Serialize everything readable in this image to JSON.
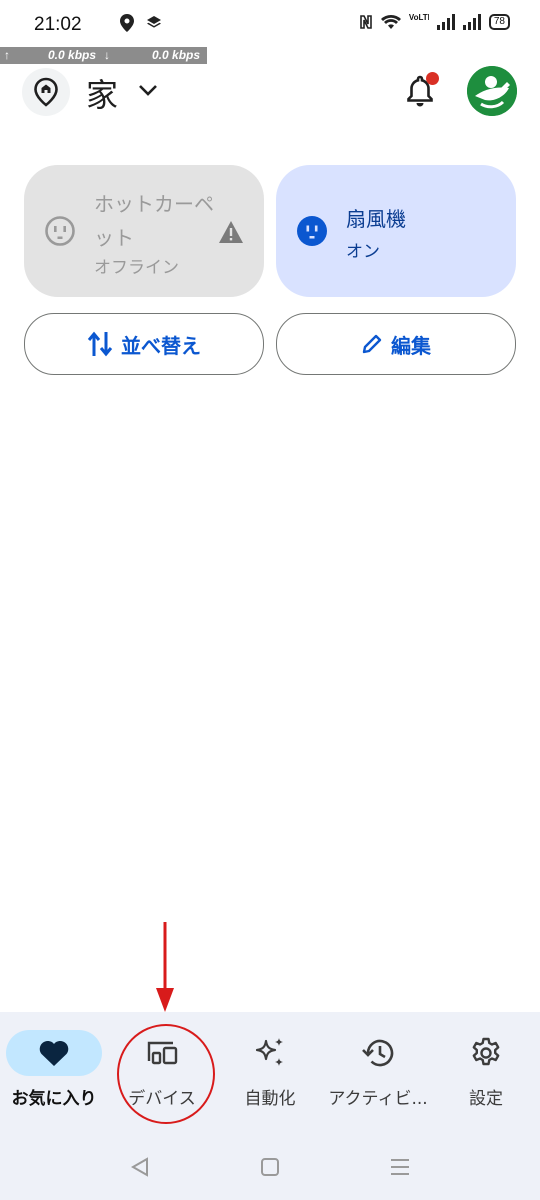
{
  "status_bar": {
    "time": "21:02",
    "battery": "78",
    "signal_tag": "VoLTE"
  },
  "network_speed": {
    "upload": "0.0 kbps",
    "download": "0.0 kbps"
  },
  "header": {
    "home_name": "家"
  },
  "devices": [
    {
      "name": "ホットカーペット",
      "status": "オフライン",
      "state": "offline"
    },
    {
      "name": "扇風機",
      "status": "オン",
      "state": "on"
    }
  ],
  "actions": {
    "sort_label": "並べ替え",
    "edit_label": "編集"
  },
  "bottom_nav": {
    "items": [
      {
        "label": "お気に入り",
        "icon": "heart-icon",
        "active": true
      },
      {
        "label": "デバイス",
        "icon": "devices-icon",
        "active": false
      },
      {
        "label": "自動化",
        "icon": "sparkle-icon",
        "active": false
      },
      {
        "label": "アクティビ...",
        "icon": "history-icon",
        "active": false
      },
      {
        "label": "設定",
        "icon": "gear-icon",
        "active": false
      }
    ]
  },
  "colors": {
    "accent": "#0b57d0",
    "tile_on_bg": "#d9e2ff",
    "tile_off_bg": "#e3e3e3",
    "nav_active_bg": "#c2e7ff",
    "nav_bg": "#eef1f8",
    "annotation": "#d81b1b"
  }
}
